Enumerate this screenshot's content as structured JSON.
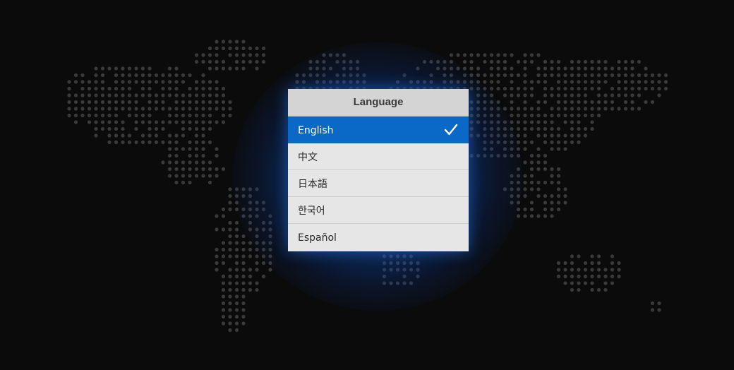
{
  "dialog": {
    "title": "Language",
    "options": [
      {
        "label": "English",
        "selected": true
      },
      {
        "label": "中文",
        "selected": false
      },
      {
        "label": "日本語",
        "selected": false
      },
      {
        "label": "한국어",
        "selected": false
      },
      {
        "label": "Español",
        "selected": false
      }
    ],
    "selected_icon": "checkmark-icon"
  },
  "background": {
    "graphic": "dotted-world-map",
    "accent_color": "#0a69c7",
    "glow_color": "#1460d2",
    "dot_color": "#3a3a3c"
  }
}
